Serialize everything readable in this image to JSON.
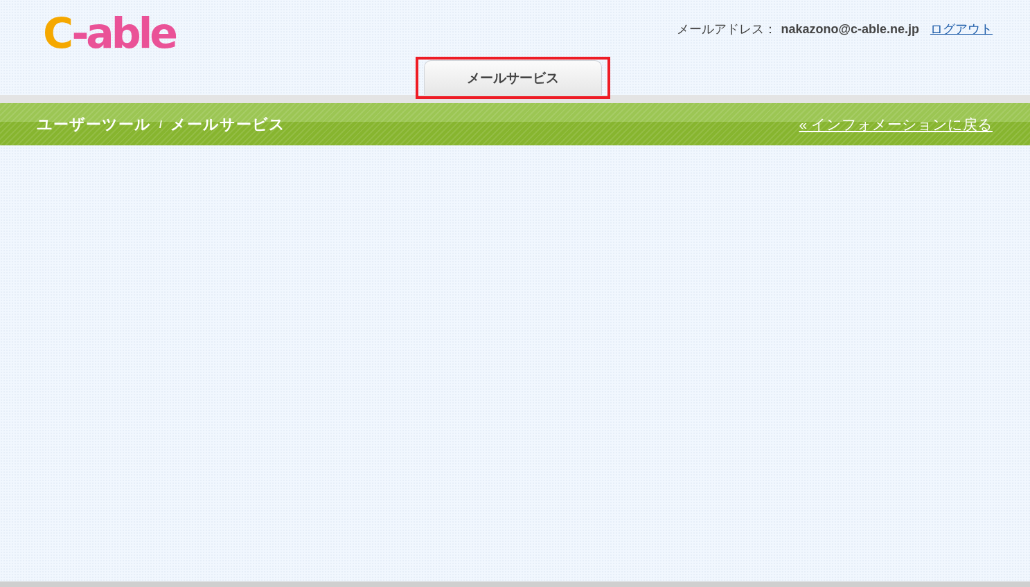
{
  "logo": {
    "parts": [
      {
        "text": "C",
        "color": "#f5a800"
      },
      {
        "text": "-able",
        "color": "#ea5297"
      }
    ]
  },
  "account": {
    "label": "メールアドレス：",
    "email": "nakazono@c-able.ne.jp",
    "logout": "ログアウト"
  },
  "tabs": [
    {
      "label": "メールサービス",
      "selected": true,
      "highlighted": true
    }
  ],
  "breadcrumb": {
    "items": [
      "ユーザーツール",
      "メールサービス"
    ],
    "separator": "/"
  },
  "back_link": "« インフォメーションに戻る"
}
